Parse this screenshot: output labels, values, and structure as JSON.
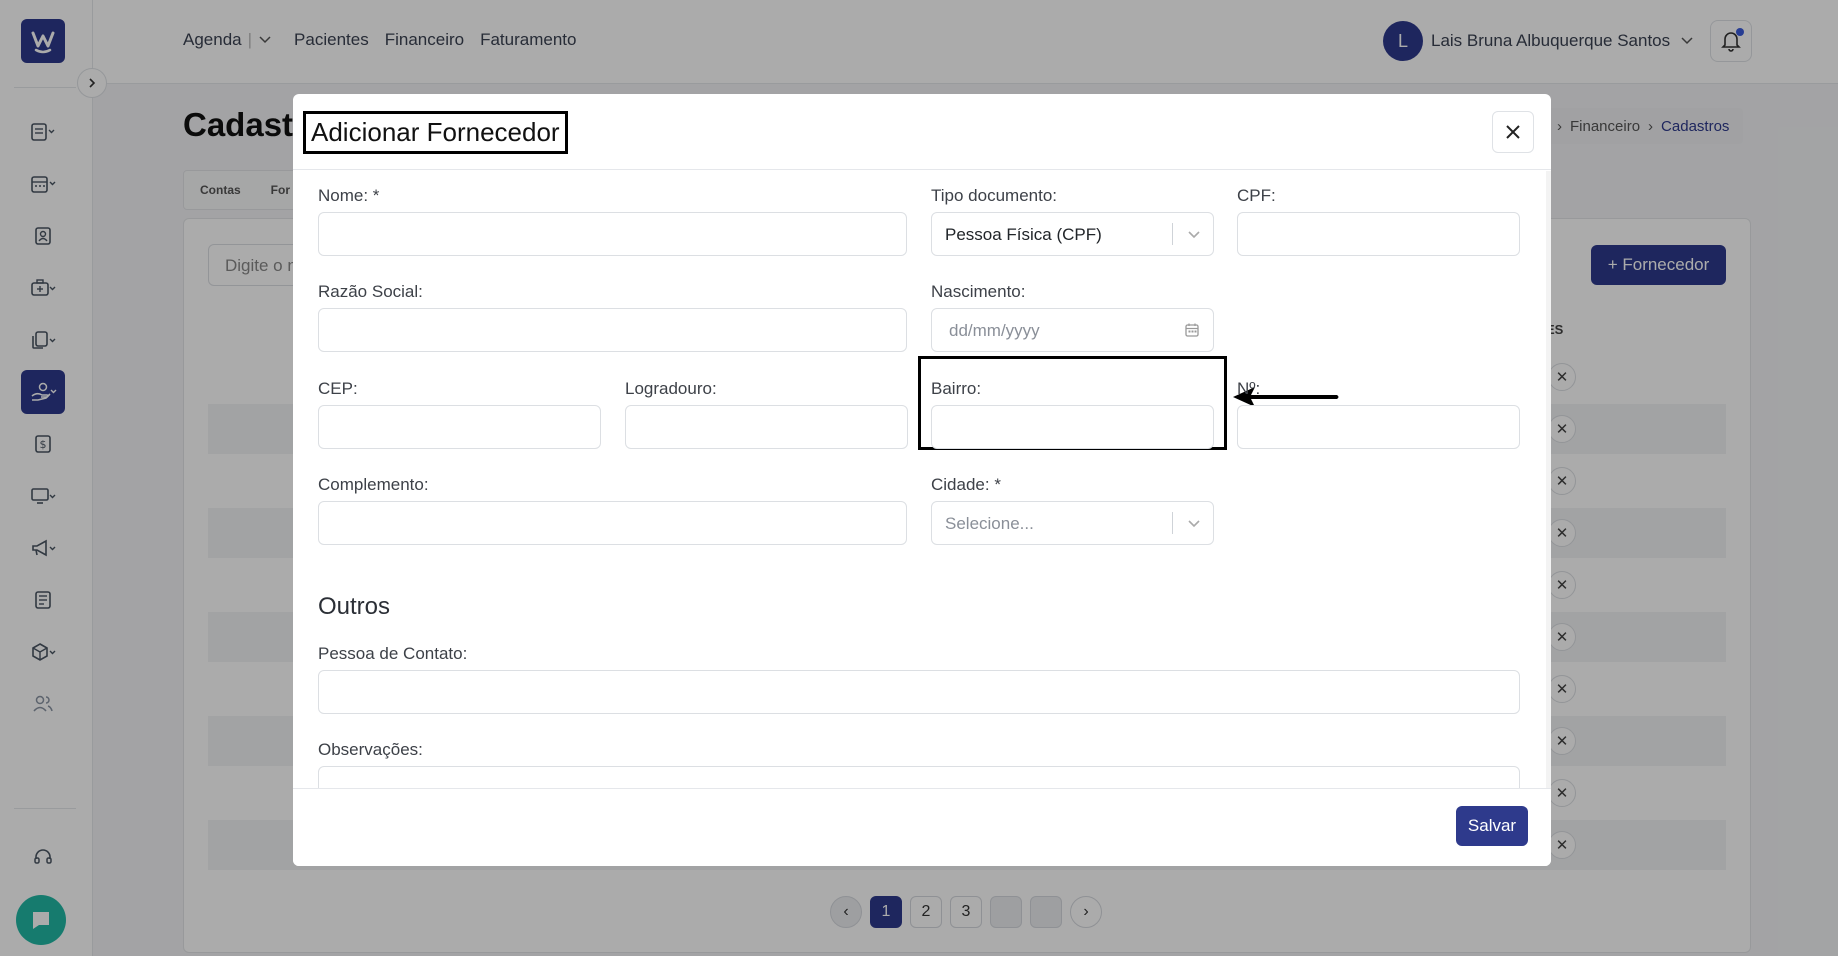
{
  "topnav": {
    "agenda": "Agenda",
    "pacientes": "Pacientes",
    "financeiro": "Financeiro",
    "faturamento": "Faturamento"
  },
  "user": {
    "initial": "L",
    "name": "Lais Bruna Albuquerque Santos"
  },
  "page": {
    "title": "Cadast",
    "breadcrumb": {
      "parent": "Financeiro",
      "current": "Cadastros"
    },
    "tabs": [
      "Contas",
      "For"
    ],
    "search_placeholder": "Digite o n",
    "add_button": "+ Fornecedor",
    "column_header": "ES",
    "pagination": [
      "1",
      "2",
      "3"
    ]
  },
  "modal": {
    "title": "Adicionar Fornecedor",
    "fields": {
      "nome": "Nome: *",
      "tipo_documento": "Tipo documento:",
      "tipo_documento_value": "Pessoa Física (CPF)",
      "cpf": "CPF:",
      "razao_social": "Razão Social:",
      "nascimento": "Nascimento:",
      "nascimento_placeholder": "dd/mm/yyyy",
      "cep": "CEP:",
      "logradouro": "Logradouro:",
      "bairro": "Bairro:",
      "numero": "Nº:",
      "complemento": "Complemento:",
      "cidade": "Cidade: *",
      "cidade_placeholder": "Selecione...",
      "outros": "Outros",
      "pessoa_contato": "Pessoa de Contato:",
      "observacoes": "Observações:"
    },
    "save": "Salvar"
  },
  "colors": {
    "primary": "#2e3a8c",
    "chat": "#22b8a5"
  }
}
